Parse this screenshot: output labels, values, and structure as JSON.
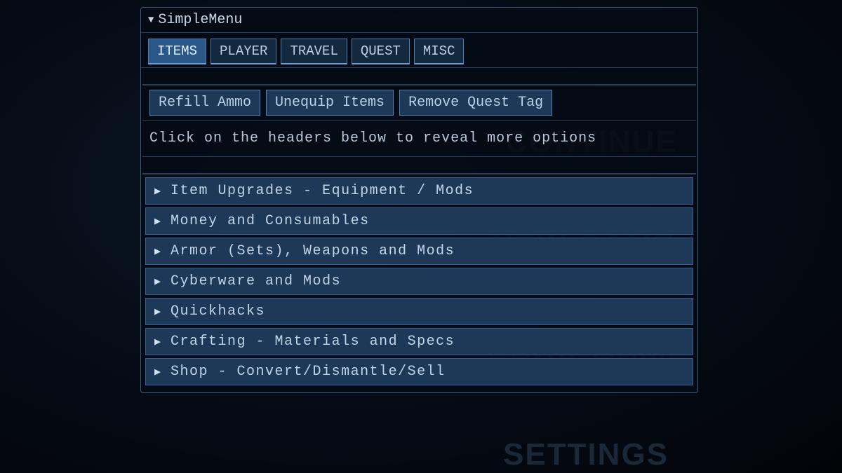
{
  "window": {
    "title": "SimpleMenu"
  },
  "tabs": [
    {
      "label": "ITEMS",
      "active": true
    },
    {
      "label": "PLAYER",
      "active": false
    },
    {
      "label": "TRAVEL",
      "active": false
    },
    {
      "label": "QUEST",
      "active": false
    },
    {
      "label": "MISC",
      "active": false
    }
  ],
  "actions": [
    {
      "label": "Refill Ammo"
    },
    {
      "label": "Unequip Items"
    },
    {
      "label": "Remove Quest Tag"
    }
  ],
  "hint": "Click on the headers below to reveal more options",
  "categories": [
    {
      "label": "Item Upgrades - Equipment / Mods"
    },
    {
      "label": "Money and Consumables"
    },
    {
      "label": "Armor (Sets), Weapons and Mods"
    },
    {
      "label": "Cyberware and Mods"
    },
    {
      "label": "Quickhacks"
    },
    {
      "label": "Crafting - Materials and Specs"
    },
    {
      "label": "Shop - Convert/Dismantle/Sell"
    }
  ],
  "background_menu": [
    {
      "label": "CONTINUE"
    },
    {
      "label": "NEW GAME"
    },
    {
      "label": "LOAD GAME"
    },
    {
      "label": "SETTINGS"
    }
  ]
}
